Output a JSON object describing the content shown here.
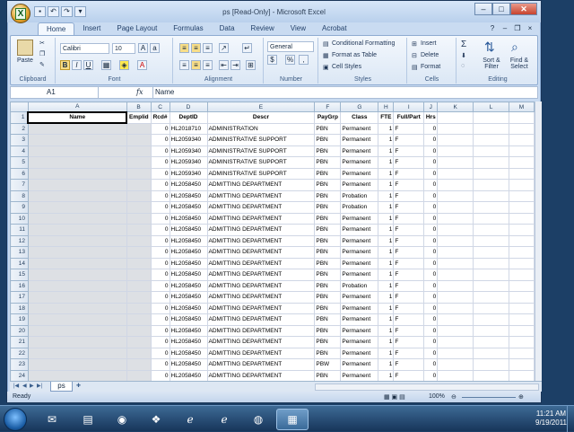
{
  "window": {
    "title": "ps  [Read-Only] - Microsoft Excel",
    "office_button": "X"
  },
  "qat": [
    "save",
    "undo",
    "redo",
    "dropdown"
  ],
  "tabs": [
    "Home",
    "Insert",
    "Page Layout",
    "Formulas",
    "Data",
    "Review",
    "View",
    "Acrobat"
  ],
  "ribbon": {
    "clipboard": {
      "label": "Clipboard",
      "paste": "Paste"
    },
    "font": {
      "label": "Font",
      "name": "Calibri",
      "size": "10",
      "bold": "B",
      "italic": "I",
      "underline": "U"
    },
    "alignment": {
      "label": "Alignment"
    },
    "number": {
      "label": "Number",
      "format": "General",
      "currency": "$",
      "percent": "%",
      "comma": ","
    },
    "styles": {
      "label": "Styles",
      "conditional": "Conditional Formatting",
      "format_table": "Format as Table",
      "cell_styles": "Cell Styles"
    },
    "cells": {
      "label": "Cells",
      "insert": "Insert",
      "delete": "Delete",
      "format": "Format"
    },
    "editing": {
      "label": "Editing",
      "sort": "Sort & Filter",
      "find": "Find & Select",
      "sum": "Σ"
    }
  },
  "formula_bar": {
    "cell_ref": "A1",
    "fx": "fx",
    "value": "Name"
  },
  "columns": [
    "A",
    "B",
    "C",
    "D",
    "E",
    "F",
    "G",
    "H",
    "I",
    "J",
    "K",
    "L",
    "M"
  ],
  "header_row": [
    "Name",
    "Emplid",
    "Rcd#",
    "DeptID",
    "Descr",
    "PayGrp",
    "Class",
    "FTE",
    "Full/Part",
    "Hrs"
  ],
  "rows": [
    [
      "0",
      "HL2018710",
      "ADMINISTRATION",
      "PBN",
      "Permanent",
      "1",
      "F",
      "0"
    ],
    [
      "0",
      "HL2059340",
      "ADMINISTRATIVE SUPPORT",
      "PBN",
      "Permanent",
      "1",
      "F",
      "0"
    ],
    [
      "0",
      "HL2059340",
      "ADMINISTRATIVE SUPPORT",
      "PBN",
      "Permanent",
      "1",
      "F",
      "0"
    ],
    [
      "0",
      "HL2059340",
      "ADMINISTRATIVE SUPPORT",
      "PBN",
      "Permanent",
      "1",
      "F",
      "0"
    ],
    [
      "0",
      "HL2059340",
      "ADMINISTRATIVE SUPPORT",
      "PBN",
      "Permanent",
      "1",
      "F",
      "0"
    ],
    [
      "0",
      "HL2058450",
      "ADMITTING DEPARTMENT",
      "PBN",
      "Permanent",
      "1",
      "F",
      "0"
    ],
    [
      "0",
      "HL2058450",
      "ADMITTING DEPARTMENT",
      "PBN",
      "Probation",
      "1",
      "F",
      "0"
    ],
    [
      "0",
      "HL2058450",
      "ADMITTING DEPARTMENT",
      "PBN",
      "Probation",
      "1",
      "F",
      "0"
    ],
    [
      "0",
      "HL2058450",
      "ADMITTING DEPARTMENT",
      "PBN",
      "Permanent",
      "1",
      "F",
      "0"
    ],
    [
      "0",
      "HL2058450",
      "ADMITTING DEPARTMENT",
      "PBN",
      "Permanent",
      "1",
      "F",
      "0"
    ],
    [
      "0",
      "HL2058450",
      "ADMITTING DEPARTMENT",
      "PBN",
      "Permanent",
      "1",
      "F",
      "0"
    ],
    [
      "0",
      "HL2058450",
      "ADMITTING DEPARTMENT",
      "PBN",
      "Permanent",
      "1",
      "F",
      "0"
    ],
    [
      "0",
      "HL2058450",
      "ADMITTING DEPARTMENT",
      "PBN",
      "Permanent",
      "1",
      "F",
      "0"
    ],
    [
      "0",
      "HL2058450",
      "ADMITTING DEPARTMENT",
      "PBN",
      "Permanent",
      "1",
      "F",
      "0"
    ],
    [
      "0",
      "HL2058450",
      "ADMITTING DEPARTMENT",
      "PBN",
      "Probation",
      "1",
      "F",
      "0"
    ],
    [
      "0",
      "HL2058450",
      "ADMITTING DEPARTMENT",
      "PBN",
      "Permanent",
      "1",
      "F",
      "0"
    ],
    [
      "0",
      "HL2058450",
      "ADMITTING DEPARTMENT",
      "PBN",
      "Permanent",
      "1",
      "F",
      "0"
    ],
    [
      "0",
      "HL2058450",
      "ADMITTING DEPARTMENT",
      "PBN",
      "Permanent",
      "1",
      "F",
      "0"
    ],
    [
      "0",
      "HL2058450",
      "ADMITTING DEPARTMENT",
      "PBN",
      "Permanent",
      "1",
      "F",
      "0"
    ],
    [
      "0",
      "HL2058450",
      "ADMITTING DEPARTMENT",
      "PBN",
      "Permanent",
      "1",
      "F",
      "0"
    ],
    [
      "0",
      "HL2058450",
      "ADMITTING DEPARTMENT",
      "PBN",
      "Permanent",
      "1",
      "F",
      "0"
    ],
    [
      "0",
      "HL2058450",
      "ADMITTING DEPARTMENT",
      "PBW",
      "Permanent",
      "1",
      "F",
      "0"
    ],
    [
      "0",
      "HL2058450",
      "ADMITTING DEPARTMENT",
      "PBN",
      "Permanent",
      "1",
      "F",
      "0"
    ]
  ],
  "sheet_tab": "ps",
  "status": {
    "text": "Ready",
    "zoom": "100%"
  },
  "taskbar": {
    "time": "11:21 AM",
    "date": "9/19/2011"
  }
}
